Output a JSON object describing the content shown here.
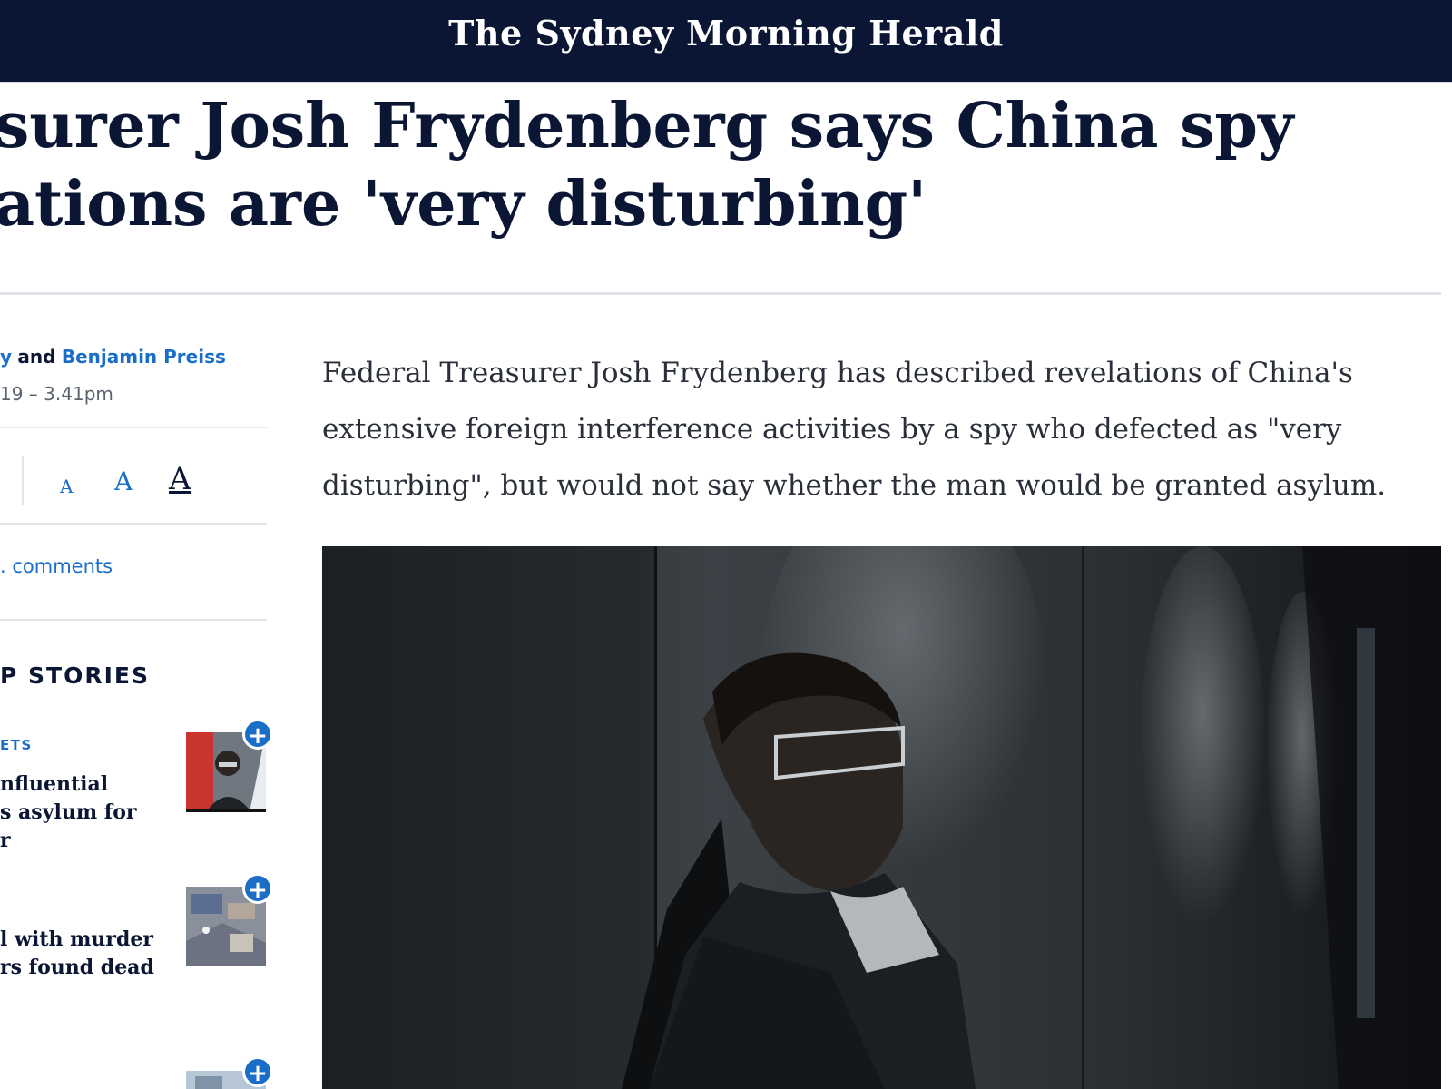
{
  "masthead": {
    "logo": "The Sydney Morning Herald"
  },
  "article": {
    "headline_lines": [
      "surer Josh Frydenberg says China spy",
      "ations are 'very disturbing'"
    ],
    "byline": {
      "author_fragment": "y",
      "conjunction": "and",
      "second_author": "Benjamin Preiss"
    },
    "dateline": "19 – 3.41pm",
    "lede_lines": [
      "Federal Treasurer Josh Frydenberg has described revelations of China's",
      "extensive foreign interference activities by a spy who defected as \"very",
      "disturbing\", but would not say whether the man would be granted asylum."
    ]
  },
  "tools": {
    "font_small": "A",
    "font_medium": "A",
    "font_large": "A",
    "comments": ". comments"
  },
  "top_stories": {
    "heading": "P STORIES",
    "items": [
      {
        "kicker": "ETS",
        "title_lines": [
          "nfluential",
          "s asylum for",
          "r"
        ],
        "action": "+"
      },
      {
        "kicker": "",
        "title_lines": [
          "l with murder",
          "rs found dead"
        ],
        "action": "+"
      },
      {
        "kicker": "",
        "title_lines": [],
        "action": "+"
      }
    ]
  },
  "colors": {
    "navy": "#0a1633",
    "link_blue": "#1a6ec7",
    "rule_grey": "#dfe2e7"
  }
}
